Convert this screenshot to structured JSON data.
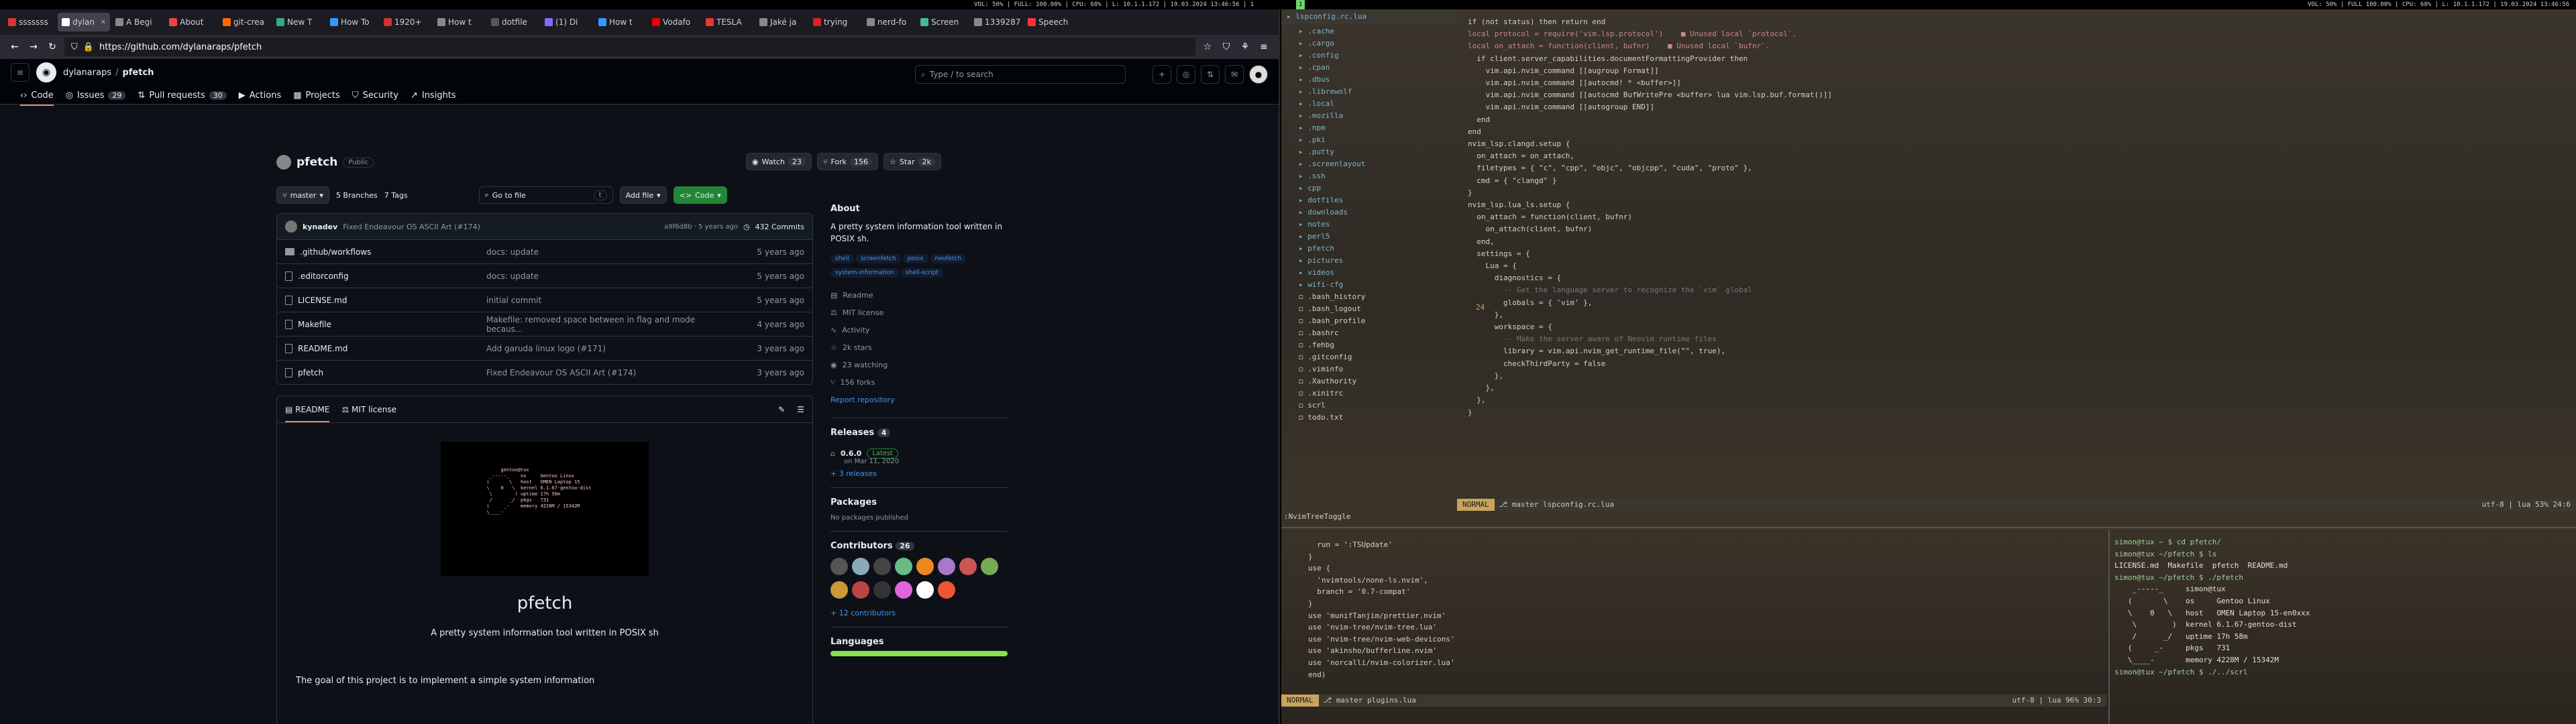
{
  "statusbar": {
    "left": "VOL: 50% | FULL: 100.00% | CPU: 68% | L: 10.1.1.172 | 19.03.2024 13:46:56 | 1",
    "right": "VOL: 50% | FULL 100.00% | CPU: 68% | L: 10.1.1.172 | 19.03.2024 13:46:56 | 2"
  },
  "browser": {
    "tabs": [
      "sssssss",
      "dylan",
      "A Begi",
      "About",
      "git-crea",
      "New T",
      "How To",
      "1920+",
      "How t",
      "dotfile",
      "(1) Di",
      "How t",
      "Vodafo",
      "TESLA",
      "Jaké ja",
      "trying",
      "nerd-fo",
      "Screen",
      "1339287",
      "Speech"
    ],
    "url": "https://github.com/dylanaraps/pfetch",
    "header": {
      "owner": "dylanaraps",
      "repo": "pfetch",
      "search_placeholder": "Type / to search"
    },
    "nav": [
      {
        "label": "Code",
        "count": ""
      },
      {
        "label": "Issues",
        "count": "29"
      },
      {
        "label": "Pull requests",
        "count": "30"
      },
      {
        "label": "Actions",
        "count": ""
      },
      {
        "label": "Projects",
        "count": ""
      },
      {
        "label": "Security",
        "count": ""
      },
      {
        "label": "Insights",
        "count": ""
      }
    ],
    "repo": {
      "name": "pfetch",
      "visibility": "Public",
      "watch": "Watch",
      "watch_count": "23",
      "fork": "Fork",
      "fork_count": "156",
      "star": "Star",
      "star_count": "2k",
      "branch": "master",
      "branches": "5 Branches",
      "tags": "7 Tags",
      "goto": "Go to file",
      "goto_key": "t",
      "add_file": "Add file",
      "code_btn": "Code",
      "commit": {
        "author": "kynadev",
        "msg": "Fixed Endeavour OS ASCII Art (#174)",
        "hash": "a9f6d8b · 5 years ago",
        "commits": "432 Commits"
      },
      "files": [
        {
          "name": ".github/workflows",
          "dir": true,
          "msg": "docs: update",
          "date": "5 years ago"
        },
        {
          "name": ".editorconfig",
          "dir": false,
          "msg": "docs: update",
          "date": "5 years ago"
        },
        {
          "name": "LICENSE.md",
          "dir": false,
          "msg": "initial commit",
          "date": "5 years ago"
        },
        {
          "name": "Makefile",
          "dir": false,
          "msg": "Makefile: removed space between in flag and mode becaus...",
          "date": "4 years ago"
        },
        {
          "name": "README.md",
          "dir": false,
          "msg": "Add garuda linux logo (#171)",
          "date": "3 years ago"
        },
        {
          "name": "pfetch",
          "dir": false,
          "msg": "Fixed Endeavour OS ASCII Art (#174)",
          "date": "3 years ago"
        }
      ]
    },
    "readme": {
      "tab1": "README",
      "tab2": "MIT license",
      "title": "pfetch",
      "subtitle": "A pretty system information tool written in POSIX sh",
      "goal": "The goal of this project is to implement a simple system information",
      "ascii": [
        "       gentoo@tux",
        "   _-----_    os     Gentoo Linux",
        "  (       \\   host   OMEN Laptop 15",
        "  \\    0   \\  kernel 6.1.67-gentoo-dist",
        "   \\        ) uptime 17h 58m",
        "   /      _/  pkgs   731",
        "  (     _-    memory 4228M / 15342M",
        "  \\____-"
      ]
    },
    "about": {
      "title": "About",
      "desc": "A pretty system information tool written in POSIX sh.",
      "topics": [
        "shell",
        "screenfetch",
        "posix",
        "neofetch",
        "system-information",
        "shell-script"
      ],
      "links": [
        "Readme",
        "MIT license",
        "Activity",
        "2k stars",
        "23 watching",
        "156 forks"
      ],
      "report": "Report repository",
      "releases": "Releases",
      "releases_count": "4",
      "release_ver": "0.6.0",
      "latest": "Latest",
      "release_date": "on Mar 11, 2020",
      "more_releases": "+ 3 releases",
      "packages": "Packages",
      "no_packages": "No packages published",
      "contributors": "Contributors",
      "contributors_count": "26",
      "more_contrib": "+ 12 contributors",
      "languages": "Languages"
    }
  },
  "term": {
    "tree_title": "lspconfig.rc.lua",
    "tree": [
      ".cache",
      ".cargo",
      ".config",
      ".cpan",
      ".dbus",
      ".librewolf",
      ".local",
      ".mozilla",
      ".npm",
      ".pki",
      ".putty",
      ".screenlayout",
      ".ssh",
      "cpp",
      "dotfiles",
      "downloads",
      "notes",
      "perl5",
      "pfetch",
      "pictures",
      "videos",
      "wifi-cfg",
      ".bash_history",
      ".bash_logout",
      ".bash_profile",
      ".bashrc",
      ".fehbg",
      ".gitconfig",
      ".viminfo",
      ".Xauthority",
      ".xinitrc",
      "scrl",
      "todo.txt"
    ],
    "code": [
      "if (not status) then return end",
      "",
      "local protocol = require('vim.lsp.protocol')    ■ Unused local `protocol`.",
      "",
      "local on_attach = function(client, bufnr)    ■ Unused local `bufnr`.",
      "  if client.server_capabilities.documentFormattingProvider then",
      "    vim.api.nvim_command [[augroup Format]]",
      "    vim.api.nvim_command [[autocmd! * <buffer>]]",
      "    vim.api.nvim_command [[autocmd BufWritePre <buffer> lua vim.lsp.buf.format()]]",
      "    vim.api.nvim_command [[autogroup END]]",
      "  end",
      "end",
      "",
      "nvim_lsp.clangd.setup {",
      "  on_attach = on_attach,",
      "  filetypes = { \"c\", \"cpp\", \"objc\", \"objcpp\", \"cuda\", \"proto\" },",
      "  cmd = { \"clangd\" }",
      "}",
      "",
      "nvim_lsp.lua_ls.setup {",
      "  on_attach = function(client, bufnr)",
      "    on_attach(client, bufnr)",
      "  end,",
      "  settings = {",
      "    Lua = {",
      "      diagnostics = {",
      "        -- Get the language server to recognize the `vim` global",
      "        globals = { 'vim' },",
      "      },",
      "",
      "      workspace = {",
      "        -- Make the server aware of Neovim runtime files",
      "        library = vim.api.nvim_get_runtime_file(\"\", true),",
      "        checkThirdParty = false",
      "      },",
      "    },",
      "  },",
      "}"
    ],
    "line_no": "24",
    "status_top": {
      "mode": "NORMAL",
      "branch": "master",
      "file": "lspconfig.rc.lua",
      "right": "utf-8 | lua  53%  24:6"
    },
    "cmdline": ":NvimTreeToggle",
    "bottom_code": [
      "  run = ':TSUpdate'",
      "}",
      "use {",
      "  'nvimtools/none-ls.nvim',",
      "  branch = '0.7-compat'",
      "}",
      "use 'munifTanjim/prettier.nvim'",
      "use 'nvim-tree/nvim-tree.lua'",
      "use 'nvim-tree/nvim-web-devicons'",
      "use 'akinsho/bufferline.nvim'",
      "use 'norcalli/nvim-colorizer.lua'",
      "end)"
    ],
    "status_bot": {
      "mode": "NORMAL",
      "branch": "master",
      "file": "plugins.lua",
      "right": "utf-8 | lua  96%  30:3"
    },
    "shell": [
      "simon@tux ~ $ cd pfetch/",
      "simon@tux ~/pfetch $ ls",
      "LICENSE.md  Makefile  pfetch  README.md",
      "simon@tux ~/pfetch $ ./pfetch",
      "    _-----_     simon@tux",
      "   (       \\    os     Gentoo Linux",
      "   \\    0   \\   host   OMEN Laptop 15-en0xxx",
      "    \\        )  kernel 6.1.67-gentoo-dist",
      "    /      _/   uptime 17h 58m",
      "   (     _-     pkgs   731",
      "   \\____-       memory 4228M / 15342M",
      "",
      "simon@tux ~/pfetch $ ./../scrl"
    ]
  }
}
